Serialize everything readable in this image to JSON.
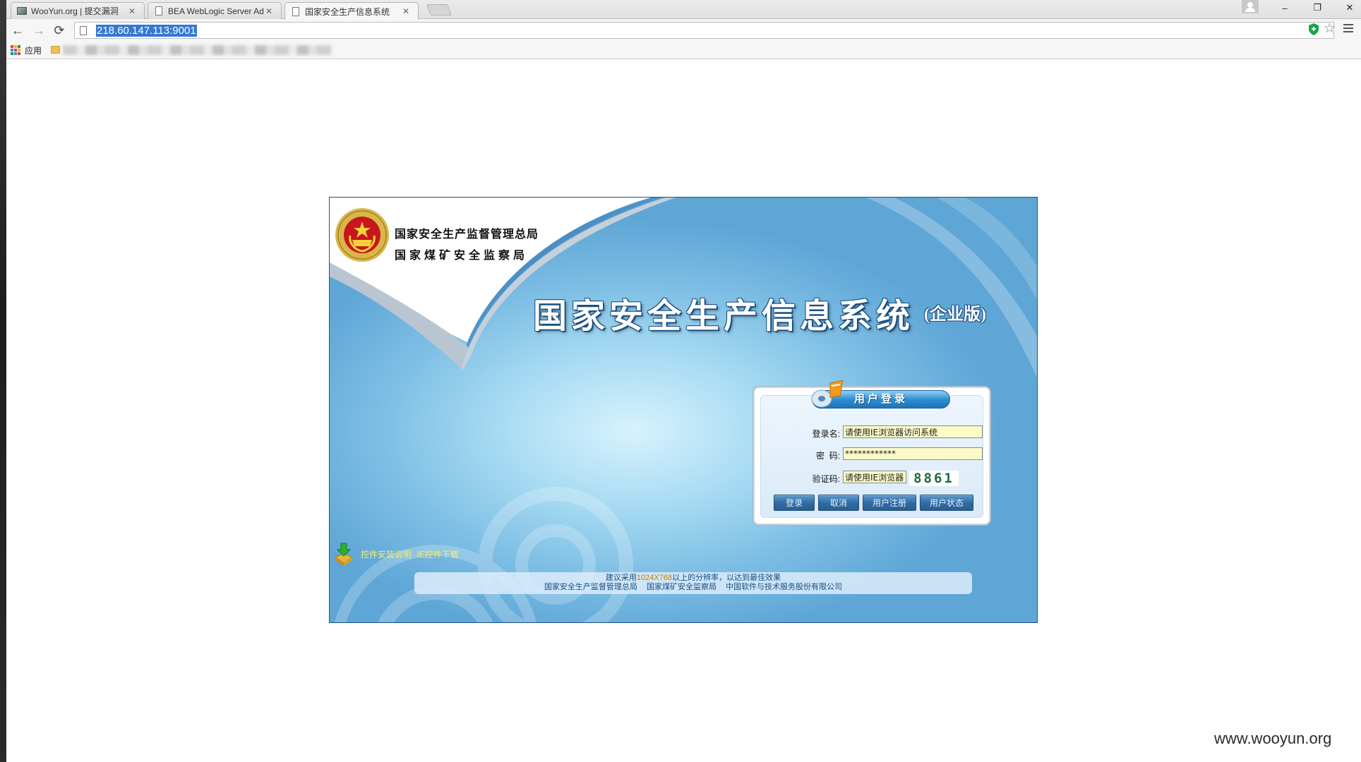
{
  "browser": {
    "tabs": [
      {
        "title": "WooYun.org | 提交漏洞",
        "icon": "wooyun-favicon-icon",
        "active": false
      },
      {
        "title": "BEA WebLogic Server Ad",
        "icon": "document-icon",
        "active": false
      },
      {
        "title": "国家安全生产信息系统",
        "icon": "document-icon",
        "active": true
      }
    ],
    "tab_close_glyph": "✕",
    "url": "218.60.147.113:9001",
    "bookmarks_apps_label": "应用",
    "window_controls": {
      "minimize": "–",
      "restore": "❐",
      "close": "✕"
    },
    "nav_glyphs": {
      "back": "←",
      "forward": "→",
      "reload": "⟳",
      "star": "☆"
    }
  },
  "page": {
    "agency_line_1": "国家安全生产监督管理总局",
    "agency_line_2": "国家煤矿安全监察局",
    "system_title": "国家安全生产信息系统",
    "system_edition": "(企业版)",
    "login": {
      "title": "用户登录",
      "username_label": "登录名:",
      "username_value": "请使用IE浏览器访问系统",
      "password_label": "密  码:",
      "password_value": "************",
      "captcha_label": "验证码:",
      "captcha_value": "请使用IE浏览器访问系统",
      "captcha_code": "8861",
      "buttons": {
        "login": "登录",
        "cancel": "取消",
        "register": "用户注册",
        "status": "用户状态"
      }
    },
    "downloads": {
      "install_guide": "控件安装说明",
      "ie_control": "IE控件下载"
    },
    "footer": {
      "recommend_prefix": "建议采用",
      "recommend_resolution": "1024X768",
      "recommend_suffix": "以上的分辨率，以达到最佳效果",
      "org_1": "国家安全生产监督管理总局",
      "org_2": "国家煤矿安全监察局",
      "org_3": "中国软件与技术服务股份有限公司"
    }
  },
  "watermark": "www.wooyun.org",
  "colors": {
    "url_highlight": "#3478d4",
    "frame_blue": "#6aaedb",
    "title_outline": "#1c4f82",
    "input_fill": "#fbfbc8",
    "captcha_text": "#1e6b3a",
    "download_link": "#f8ee6a",
    "footer_text": "#1a4f86"
  }
}
